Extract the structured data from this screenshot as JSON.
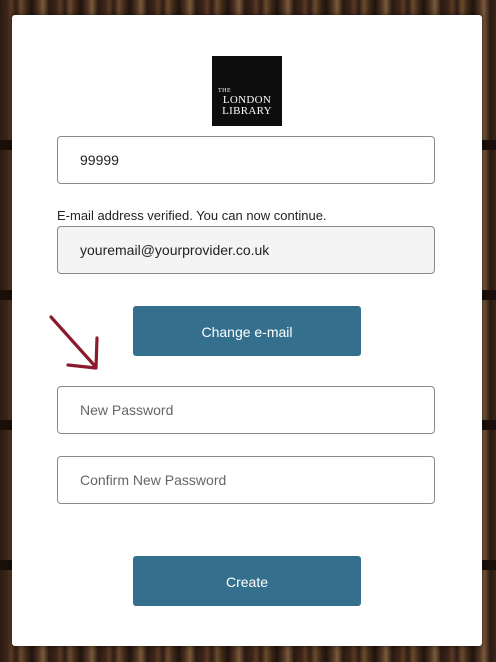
{
  "logo": {
    "line1": "THE",
    "line2": "LONDON",
    "line3": "LIBRARY"
  },
  "code_field": {
    "value": "99999"
  },
  "verification": {
    "message": "E-mail address verified. You can now continue."
  },
  "email_field": {
    "value": "youremail@yourprovider.co.uk"
  },
  "change_email_button": {
    "label": "Change e-mail"
  },
  "new_password_field": {
    "placeholder": "New Password"
  },
  "confirm_password_field": {
    "placeholder": "Confirm New Password"
  },
  "create_button": {
    "label": "Create"
  },
  "colors": {
    "button": "#34708e",
    "arrow": "#8b1a2e",
    "card": "#ffffff"
  }
}
